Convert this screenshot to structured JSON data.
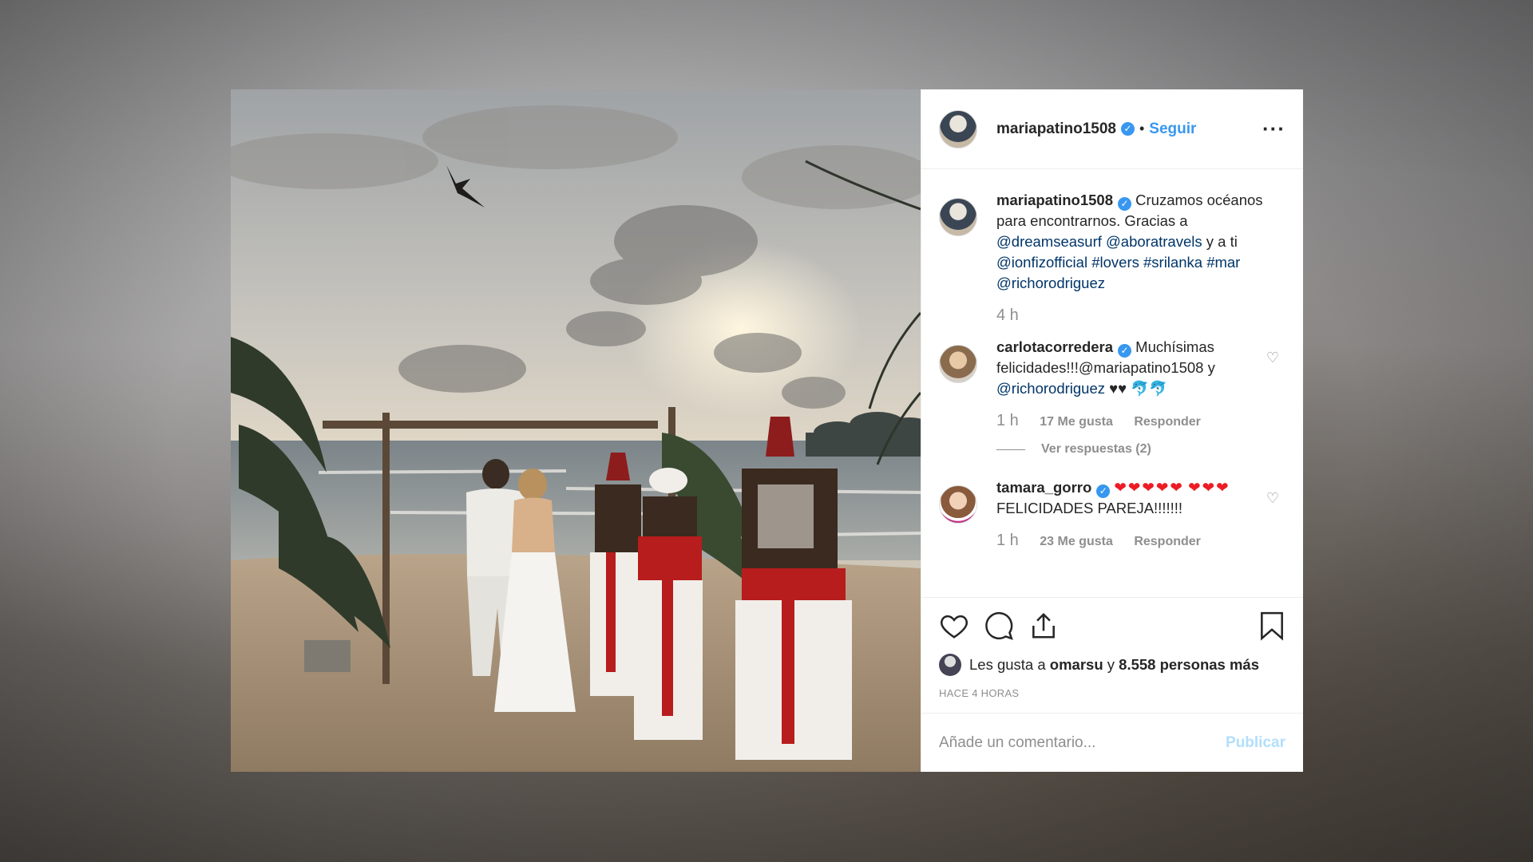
{
  "post": {
    "username": "mariapatino1508",
    "verified_mark": "✓",
    "separator": "•",
    "follow_label": "Seguir",
    "more_label": "···",
    "caption": {
      "username": "mariapatino1508",
      "text1": "Cruzamos océanos para encontrarnos. Gracias a",
      "mention1": "@dreamseasurf",
      "mention2": "@aboratravels",
      "text2": "y a ti",
      "mention3": "@ionfizofficial",
      "tag1": "#lovers",
      "tag2": "#srilanka",
      "tag3": "#mar",
      "mention4": "@richorodriguez",
      "time": "4 h"
    }
  },
  "comments": [
    {
      "username": "carlotacorredera",
      "text": "Muchísimas felicidades!!!@mariapatino1508 y",
      "mention": "@richorodriguez",
      "emoji": "♥♥ 🐬🐬",
      "time": "1 h",
      "likes": "17 Me gusta",
      "reply": "Responder",
      "view_replies": "Ver respuestas (2)"
    },
    {
      "username": "tamara_gorro",
      "hearts1": "❤❤❤❤❤",
      "hearts2": "❤❤❤",
      "text": "FELICIDADES PAREJA!!!!!!!",
      "time": "1 h",
      "likes": "23 Me gusta",
      "reply": "Responder"
    }
  ],
  "actions": {
    "likes_prefix": "Les gusta a",
    "likes_user": "omarsu",
    "likes_and": "y",
    "likes_rest": "8.558 personas más",
    "time_ago": "HACE 4 HORAS"
  },
  "add_comment": {
    "placeholder": "Añade un comentario...",
    "publish": "Publicar"
  },
  "icons": [
    "heart-icon",
    "comment-icon",
    "share-icon",
    "bookmark-icon"
  ],
  "colors": {
    "link": "#003569",
    "accent": "#3897f0",
    "publish_disabled": "#b2dffc"
  }
}
